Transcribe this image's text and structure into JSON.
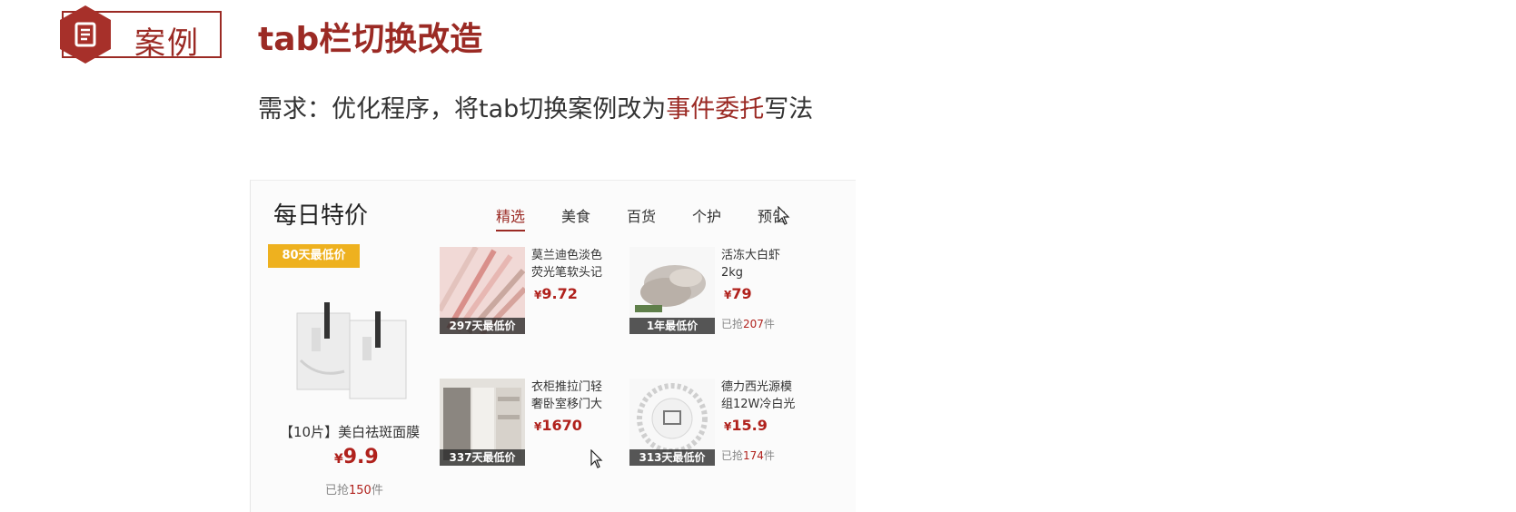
{
  "header": {
    "badge_label": "案例",
    "title": "tab栏切换改造"
  },
  "requirement": {
    "prefix": "需求：优化程序，将tab切换案例改为",
    "highlight": "事件委托",
    "suffix": "写法"
  },
  "panel": {
    "title": "每日特价",
    "tabs": [
      {
        "label": "精选",
        "active": true
      },
      {
        "label": "美食",
        "active": false
      },
      {
        "label": "百货",
        "active": false
      },
      {
        "label": "个护",
        "active": false
      },
      {
        "label": "预告",
        "active": false
      }
    ],
    "featured": {
      "ribbon": "80天最低价",
      "name": "【10片】美白祛斑面膜",
      "currency": "¥",
      "price": "9.9",
      "sold_prefix": "已抢",
      "sold_count": "150",
      "sold_suffix": "件"
    },
    "products": [
      {
        "badge": "297天最低价",
        "name": "莫兰迪色淡色荧光笔软头记",
        "currency": "¥",
        "price": "9.72",
        "sold_prefix": "",
        "sold_count": "",
        "sold_suffix": ""
      },
      {
        "badge": "1年最低价",
        "name": "活冻大白虾2kg",
        "currency": "¥",
        "price": "79",
        "sold_prefix": "已抢",
        "sold_count": "207",
        "sold_suffix": "件"
      },
      {
        "badge": "337天最低价",
        "name": "衣柜推拉门轻奢卧室移门大",
        "currency": "¥",
        "price": "1670",
        "sold_prefix": "",
        "sold_count": "",
        "sold_suffix": ""
      },
      {
        "badge": "313天最低价",
        "name": "德力西光源模组12W冷白光",
        "currency": "¥",
        "price": "15.9",
        "sold_prefix": "已抢",
        "sold_count": "174",
        "sold_suffix": "件"
      }
    ]
  },
  "colors": {
    "accent": "#9b2a24",
    "price": "#b0211c",
    "ribbon": "#eeb11f"
  }
}
